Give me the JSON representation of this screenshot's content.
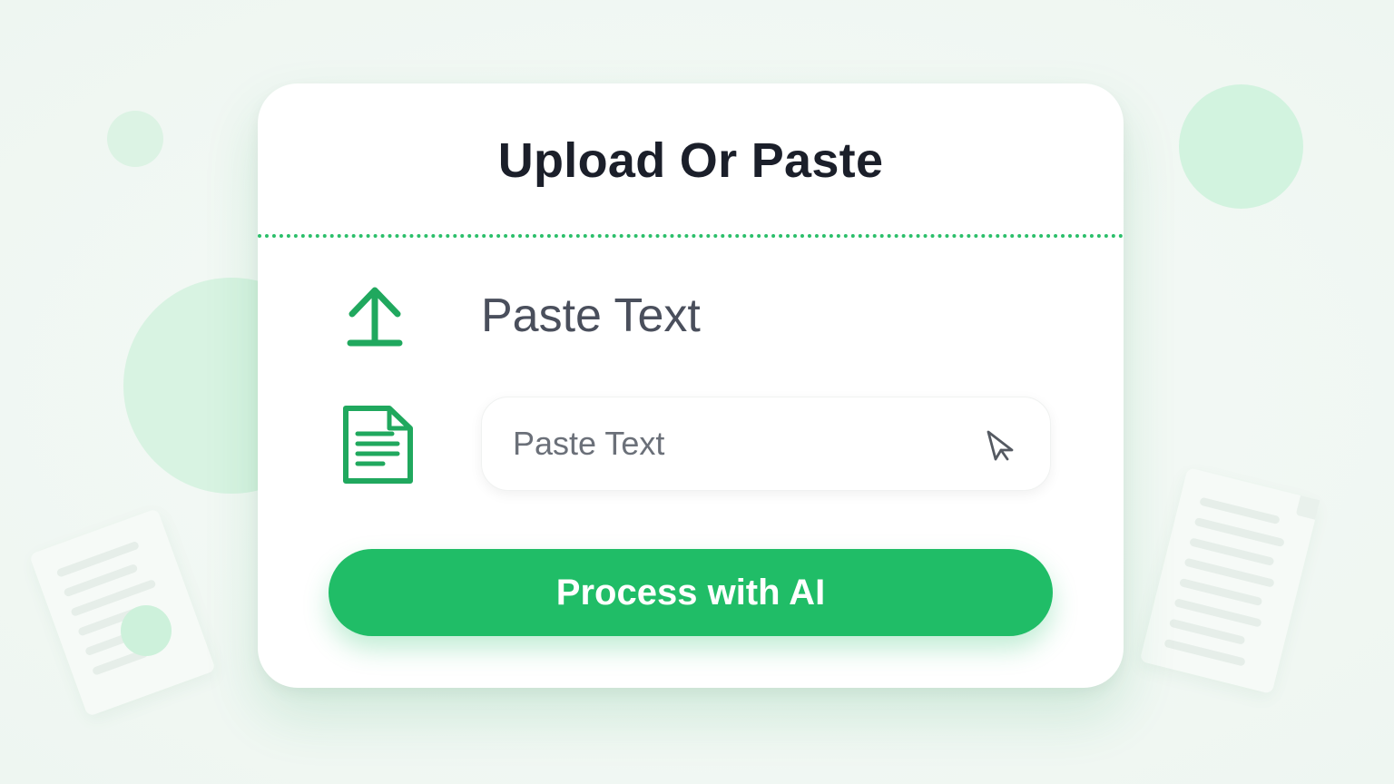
{
  "card": {
    "title": "Upload Or Paste",
    "paste_label": "Paste Text",
    "input_placeholder": "Paste Text",
    "process_button": "Process with AI"
  },
  "icons": {
    "upload": "upload-arrow-icon",
    "document": "document-icon",
    "cursor": "cursor-icon"
  },
  "colors": {
    "accent": "#20bd67",
    "title": "#1b1f2a",
    "background": "#f1f7f3"
  }
}
